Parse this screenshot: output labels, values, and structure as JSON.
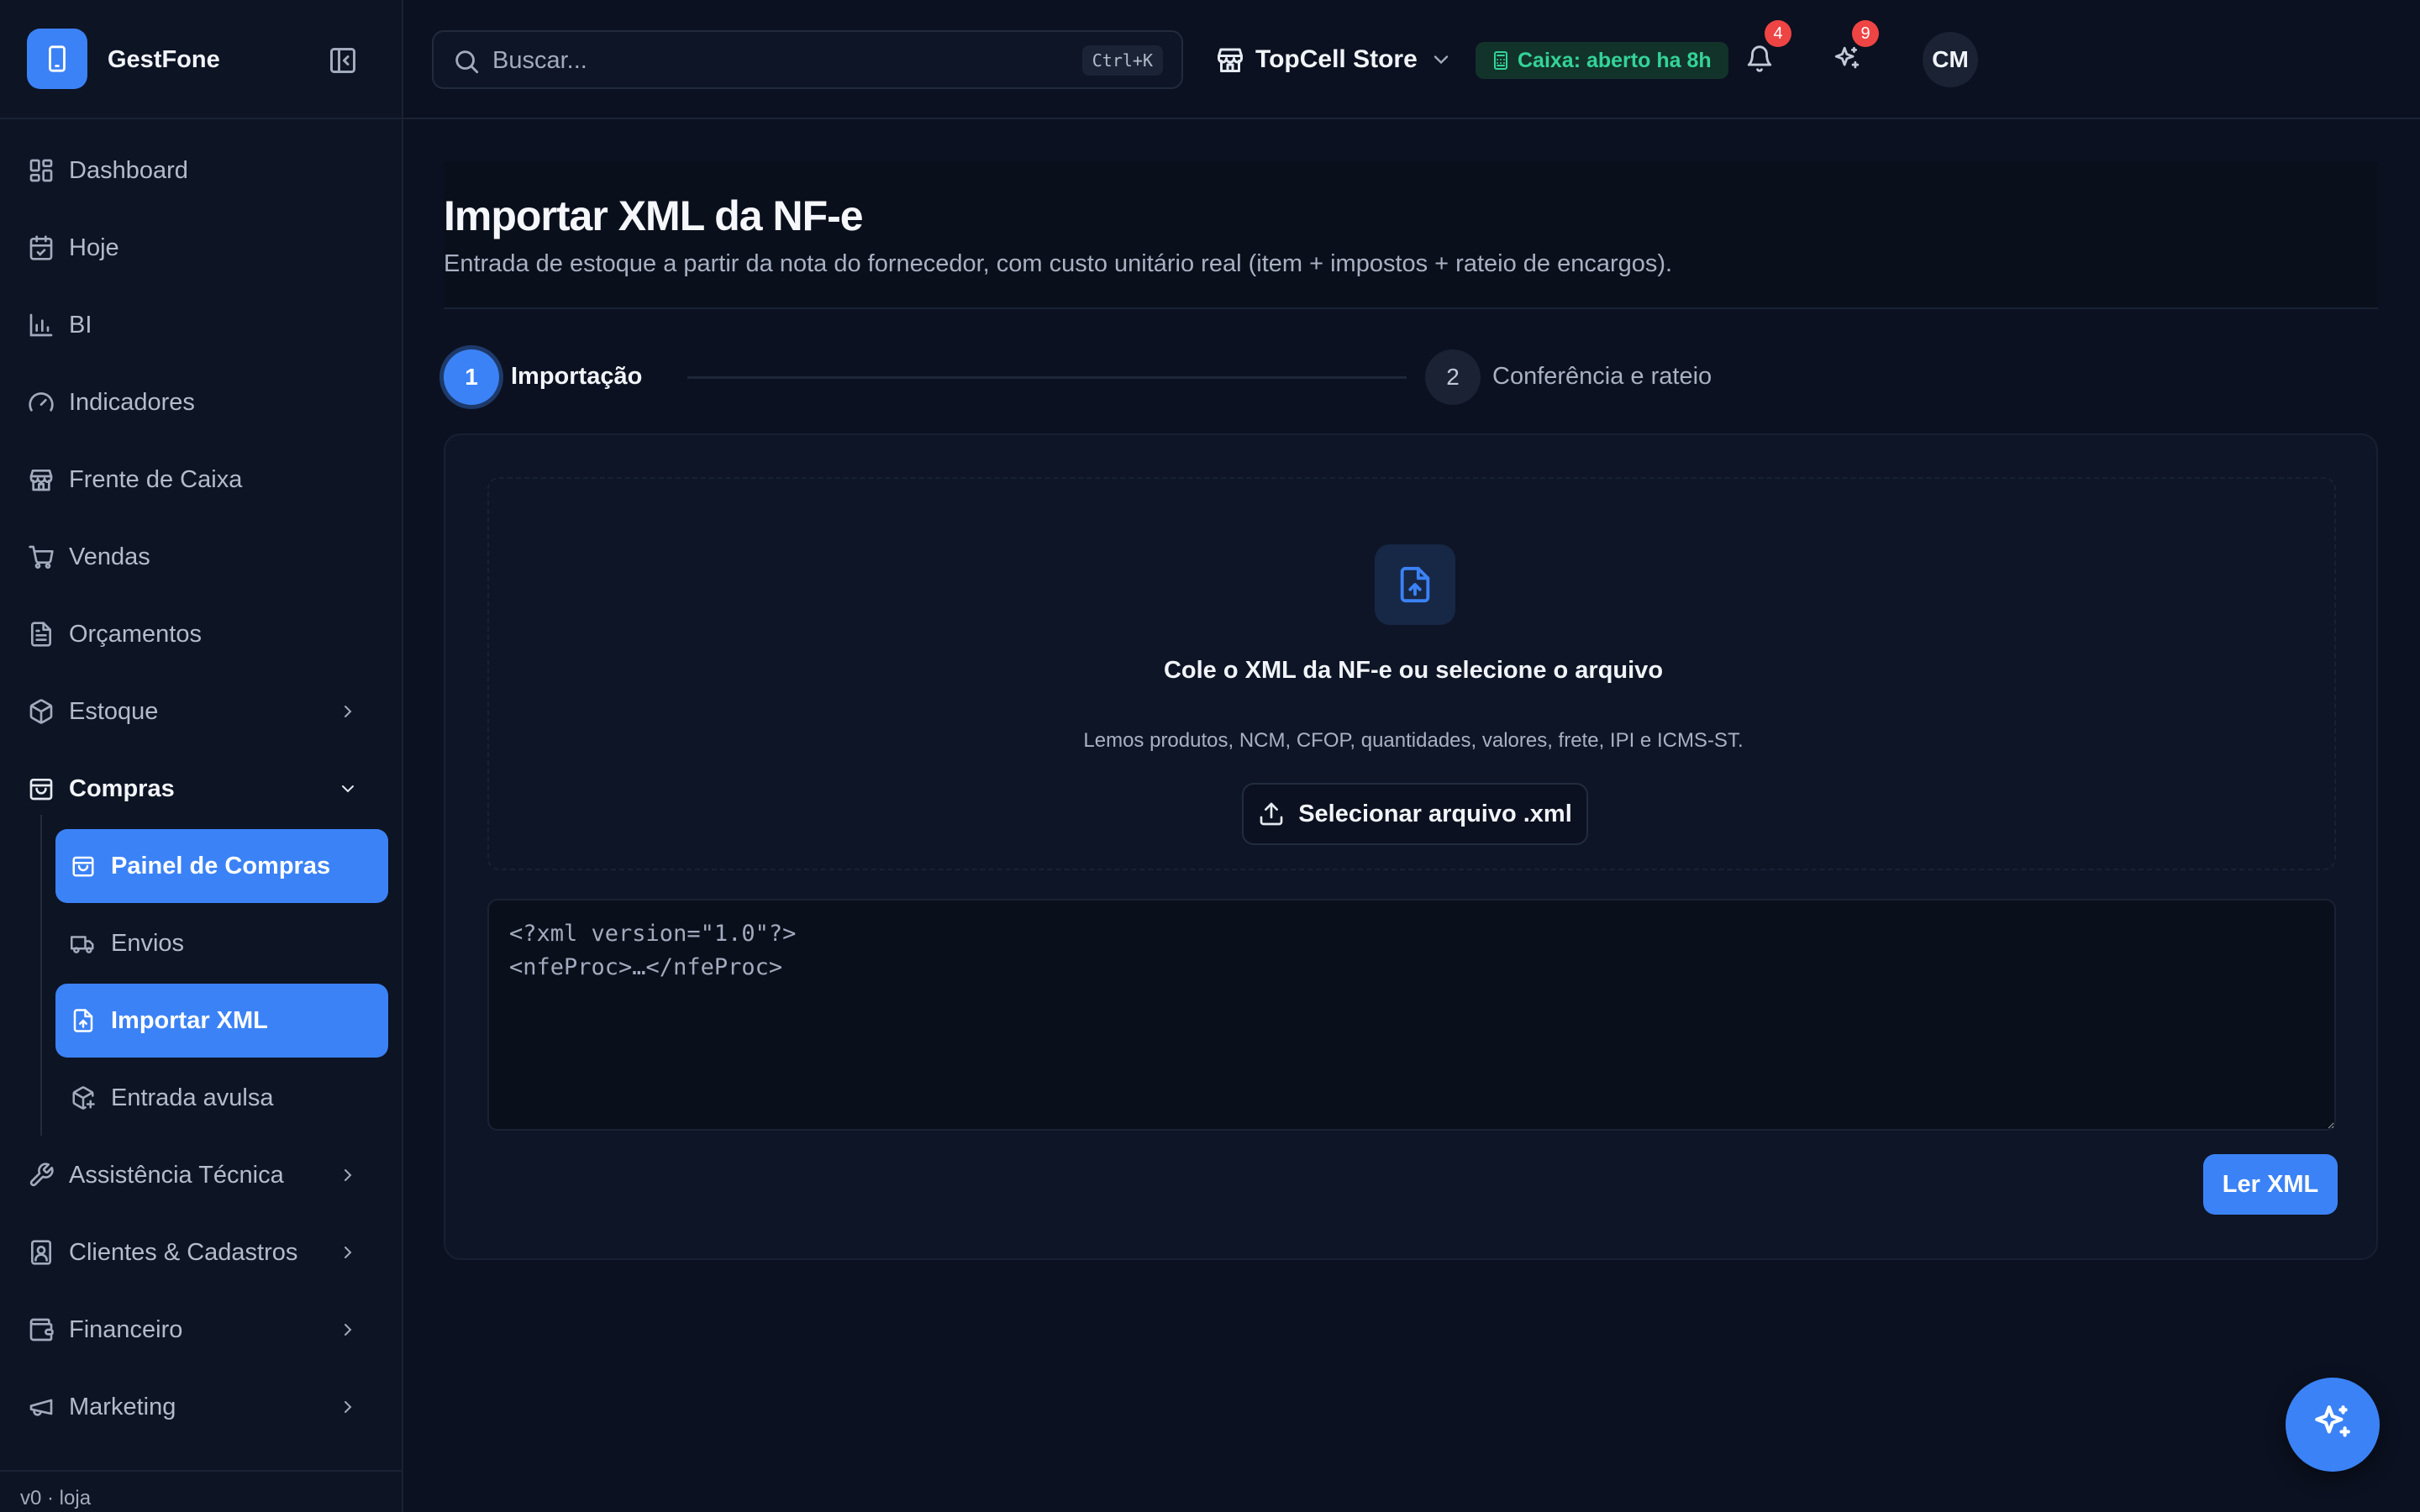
{
  "brand": {
    "name": "GestFone"
  },
  "sidebar": {
    "items": [
      {
        "label": "Dashboard"
      },
      {
        "label": "Hoje"
      },
      {
        "label": "BI"
      },
      {
        "label": "Indicadores"
      },
      {
        "label": "Frente de Caixa"
      },
      {
        "label": "Vendas"
      },
      {
        "label": "Orçamentos"
      },
      {
        "label": "Estoque"
      },
      {
        "label": "Compras"
      },
      {
        "label": "Assistência Técnica"
      },
      {
        "label": "Clientes & Cadastros"
      },
      {
        "label": "Financeiro"
      },
      {
        "label": "Marketing"
      }
    ],
    "compras_sub": [
      {
        "label": "Painel de Compras"
      },
      {
        "label": "Envios"
      },
      {
        "label": "Importar XML"
      },
      {
        "label": "Entrada avulsa"
      }
    ],
    "footer": "v0 · loja"
  },
  "topbar": {
    "search_placeholder": "Buscar...",
    "shortcut": "Ctrl+K",
    "store": "TopCell Store",
    "caixa_status": "Caixa: aberto ha 8h",
    "notifications_count": "4",
    "ai_count": "9",
    "avatar_initials": "CM"
  },
  "page": {
    "title": "Importar XML da NF-e",
    "subtitle": "Entrada de estoque a partir da nota do fornecedor, com custo unitário real (item + impostos + rateio de encargos)."
  },
  "stepper": {
    "steps": [
      {
        "number": "1",
        "label": "Importação"
      },
      {
        "number": "2",
        "label": "Conferência e rateio"
      }
    ]
  },
  "dropzone": {
    "title": "Cole o XML da NF-e ou selecione o arquivo",
    "subtitle": "Lemos produtos, NCM, CFOP, quantidades, valores, frete, IPI e ICMS-ST.",
    "button_label": "Selecionar arquivo .xml"
  },
  "xml_input": {
    "placeholder": "<?xml version=\"1.0\"?>\n<nfeProc>…</nfeProc>"
  },
  "actions": {
    "read_label": "Ler XML"
  },
  "colors": {
    "accent": "#3b82f6",
    "background": "#0b1120",
    "success": "#34d399",
    "badge": "#ef4444"
  }
}
